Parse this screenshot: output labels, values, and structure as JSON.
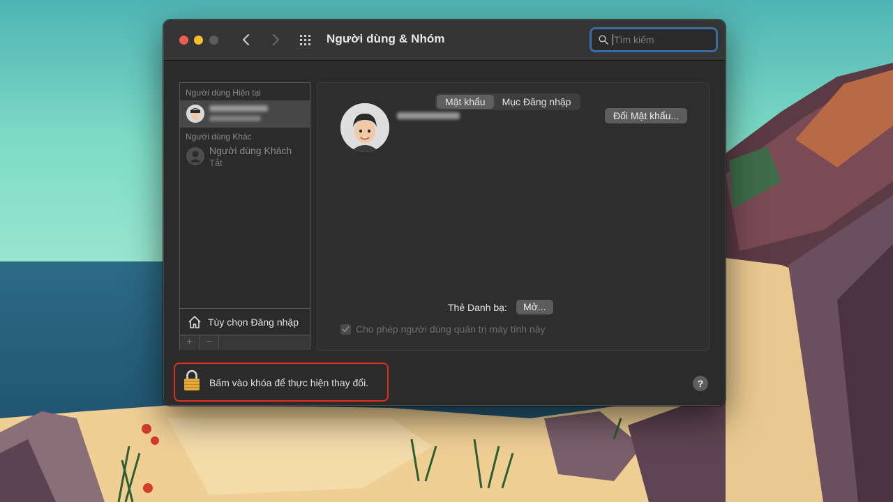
{
  "window": {
    "title": "Người dùng & Nhóm"
  },
  "search": {
    "placeholder": "Tìm kiếm"
  },
  "sidebar": {
    "current_users_header": "Người dùng Hiện tại",
    "other_users_header": "Người dùng Khác",
    "guest": {
      "name": "Người dùng Khách",
      "status": "Tắt"
    },
    "login_options_label": "Tùy chọn Đăng nhập",
    "add_label": "+",
    "remove_label": "−"
  },
  "tabs": [
    {
      "label": "Mật khẩu",
      "active": true
    },
    {
      "label": "Mục Đăng nhập",
      "active": false
    }
  ],
  "panel": {
    "change_password_label": "Đổi Mật khẩu...",
    "contact_card_label": "Thẻ Danh bạ:",
    "open_button_label": "Mở...",
    "allow_admin_label": "Cho phép người dùng quản trị máy tính này",
    "allow_admin_checked": true
  },
  "footer": {
    "lock_message": "Bấm vào khóa để thực hiện thay đổi.",
    "help_label": "?"
  },
  "colors": {
    "highlight": "#e0301e",
    "search_focus": "#3b6da3"
  }
}
